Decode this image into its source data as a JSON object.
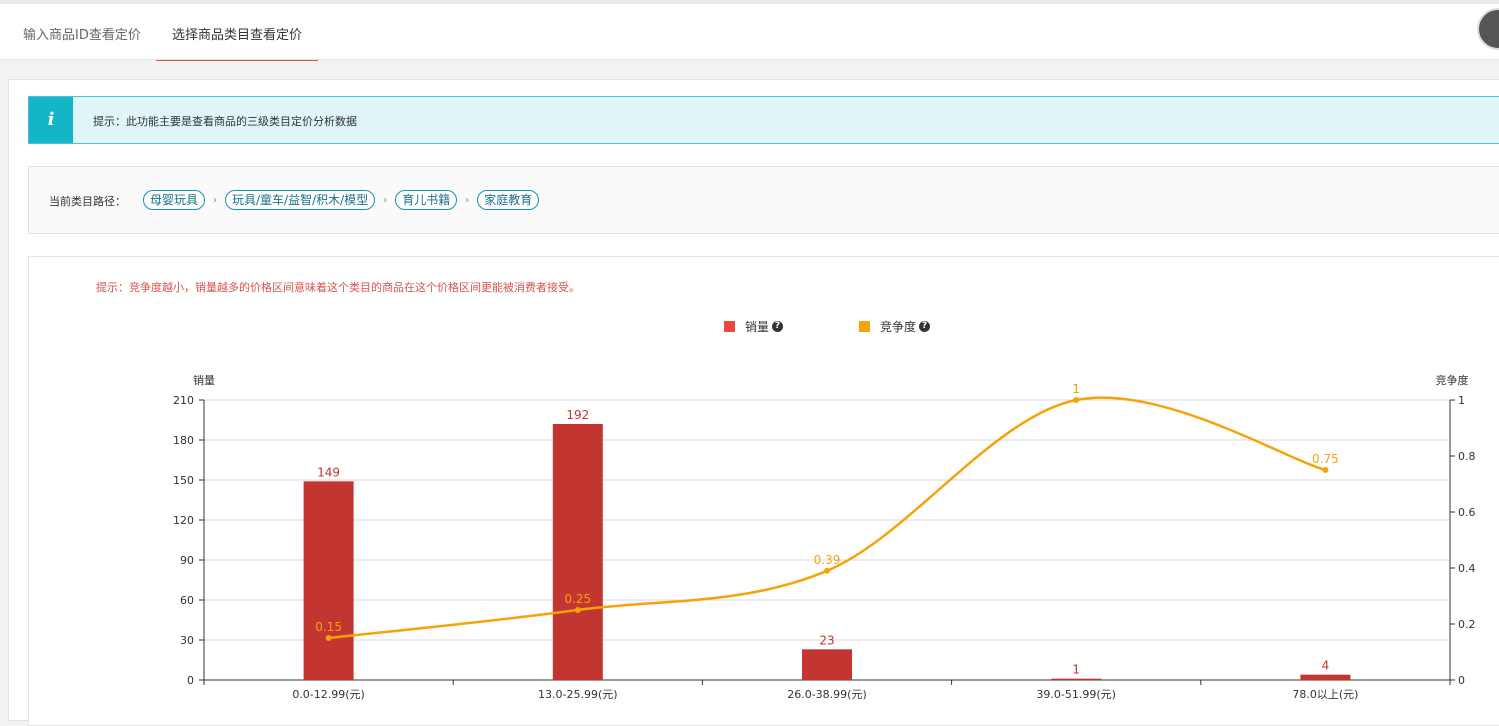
{
  "tabs": [
    {
      "label": "输入商品ID查看定价",
      "active": false
    },
    {
      "label": "选择商品类目查看定价",
      "active": true
    }
  ],
  "tip": {
    "icon": "info-icon",
    "icon_glyph": "i",
    "text": "提示：此功能主要是查看商品的三级类目定价分析数据"
  },
  "category_path": {
    "label": "当前类目路径：",
    "separator": "›",
    "items": [
      "母婴玩具",
      "玩具/童车/益智/积木/模型",
      "育儿书籍",
      "家庭教育"
    ]
  },
  "chart_tip": "提示：竞争度越小，销量越多的价格区间意味着这个类目的商品在这个价格区间更能被消费者接受。",
  "help_glyph": "?",
  "chart_data": {
    "type": "bar",
    "categories": [
      "0.0-12.99(元)",
      "13.0-25.99(元)",
      "26.0-38.99(元)",
      "39.0-51.99(元)",
      "78.0以上(元)"
    ],
    "series": [
      {
        "name": "销量",
        "type": "bar",
        "axis": "left",
        "color": "#c23531",
        "values": [
          149,
          192,
          23,
          1,
          4
        ]
      },
      {
        "name": "竞争度",
        "type": "line",
        "axis": "right",
        "color": "#f5a30a",
        "values": [
          0.15,
          0.25,
          0.39,
          1,
          0.75
        ]
      }
    ],
    "ylabel": "销量",
    "ylabel_right": "竞争度",
    "ylim": [
      0,
      210
    ],
    "yticks": [
      0,
      30,
      60,
      90,
      120,
      150,
      180,
      210
    ],
    "ylim_right": [
      0,
      1
    ],
    "yticks_right": [
      0,
      0.2,
      0.4,
      0.6,
      0.8,
      1
    ],
    "grid": true,
    "legend_position": "top-center",
    "legend_color_bar": "#e84a3c",
    "legend_color_line": "#f5a30a"
  }
}
